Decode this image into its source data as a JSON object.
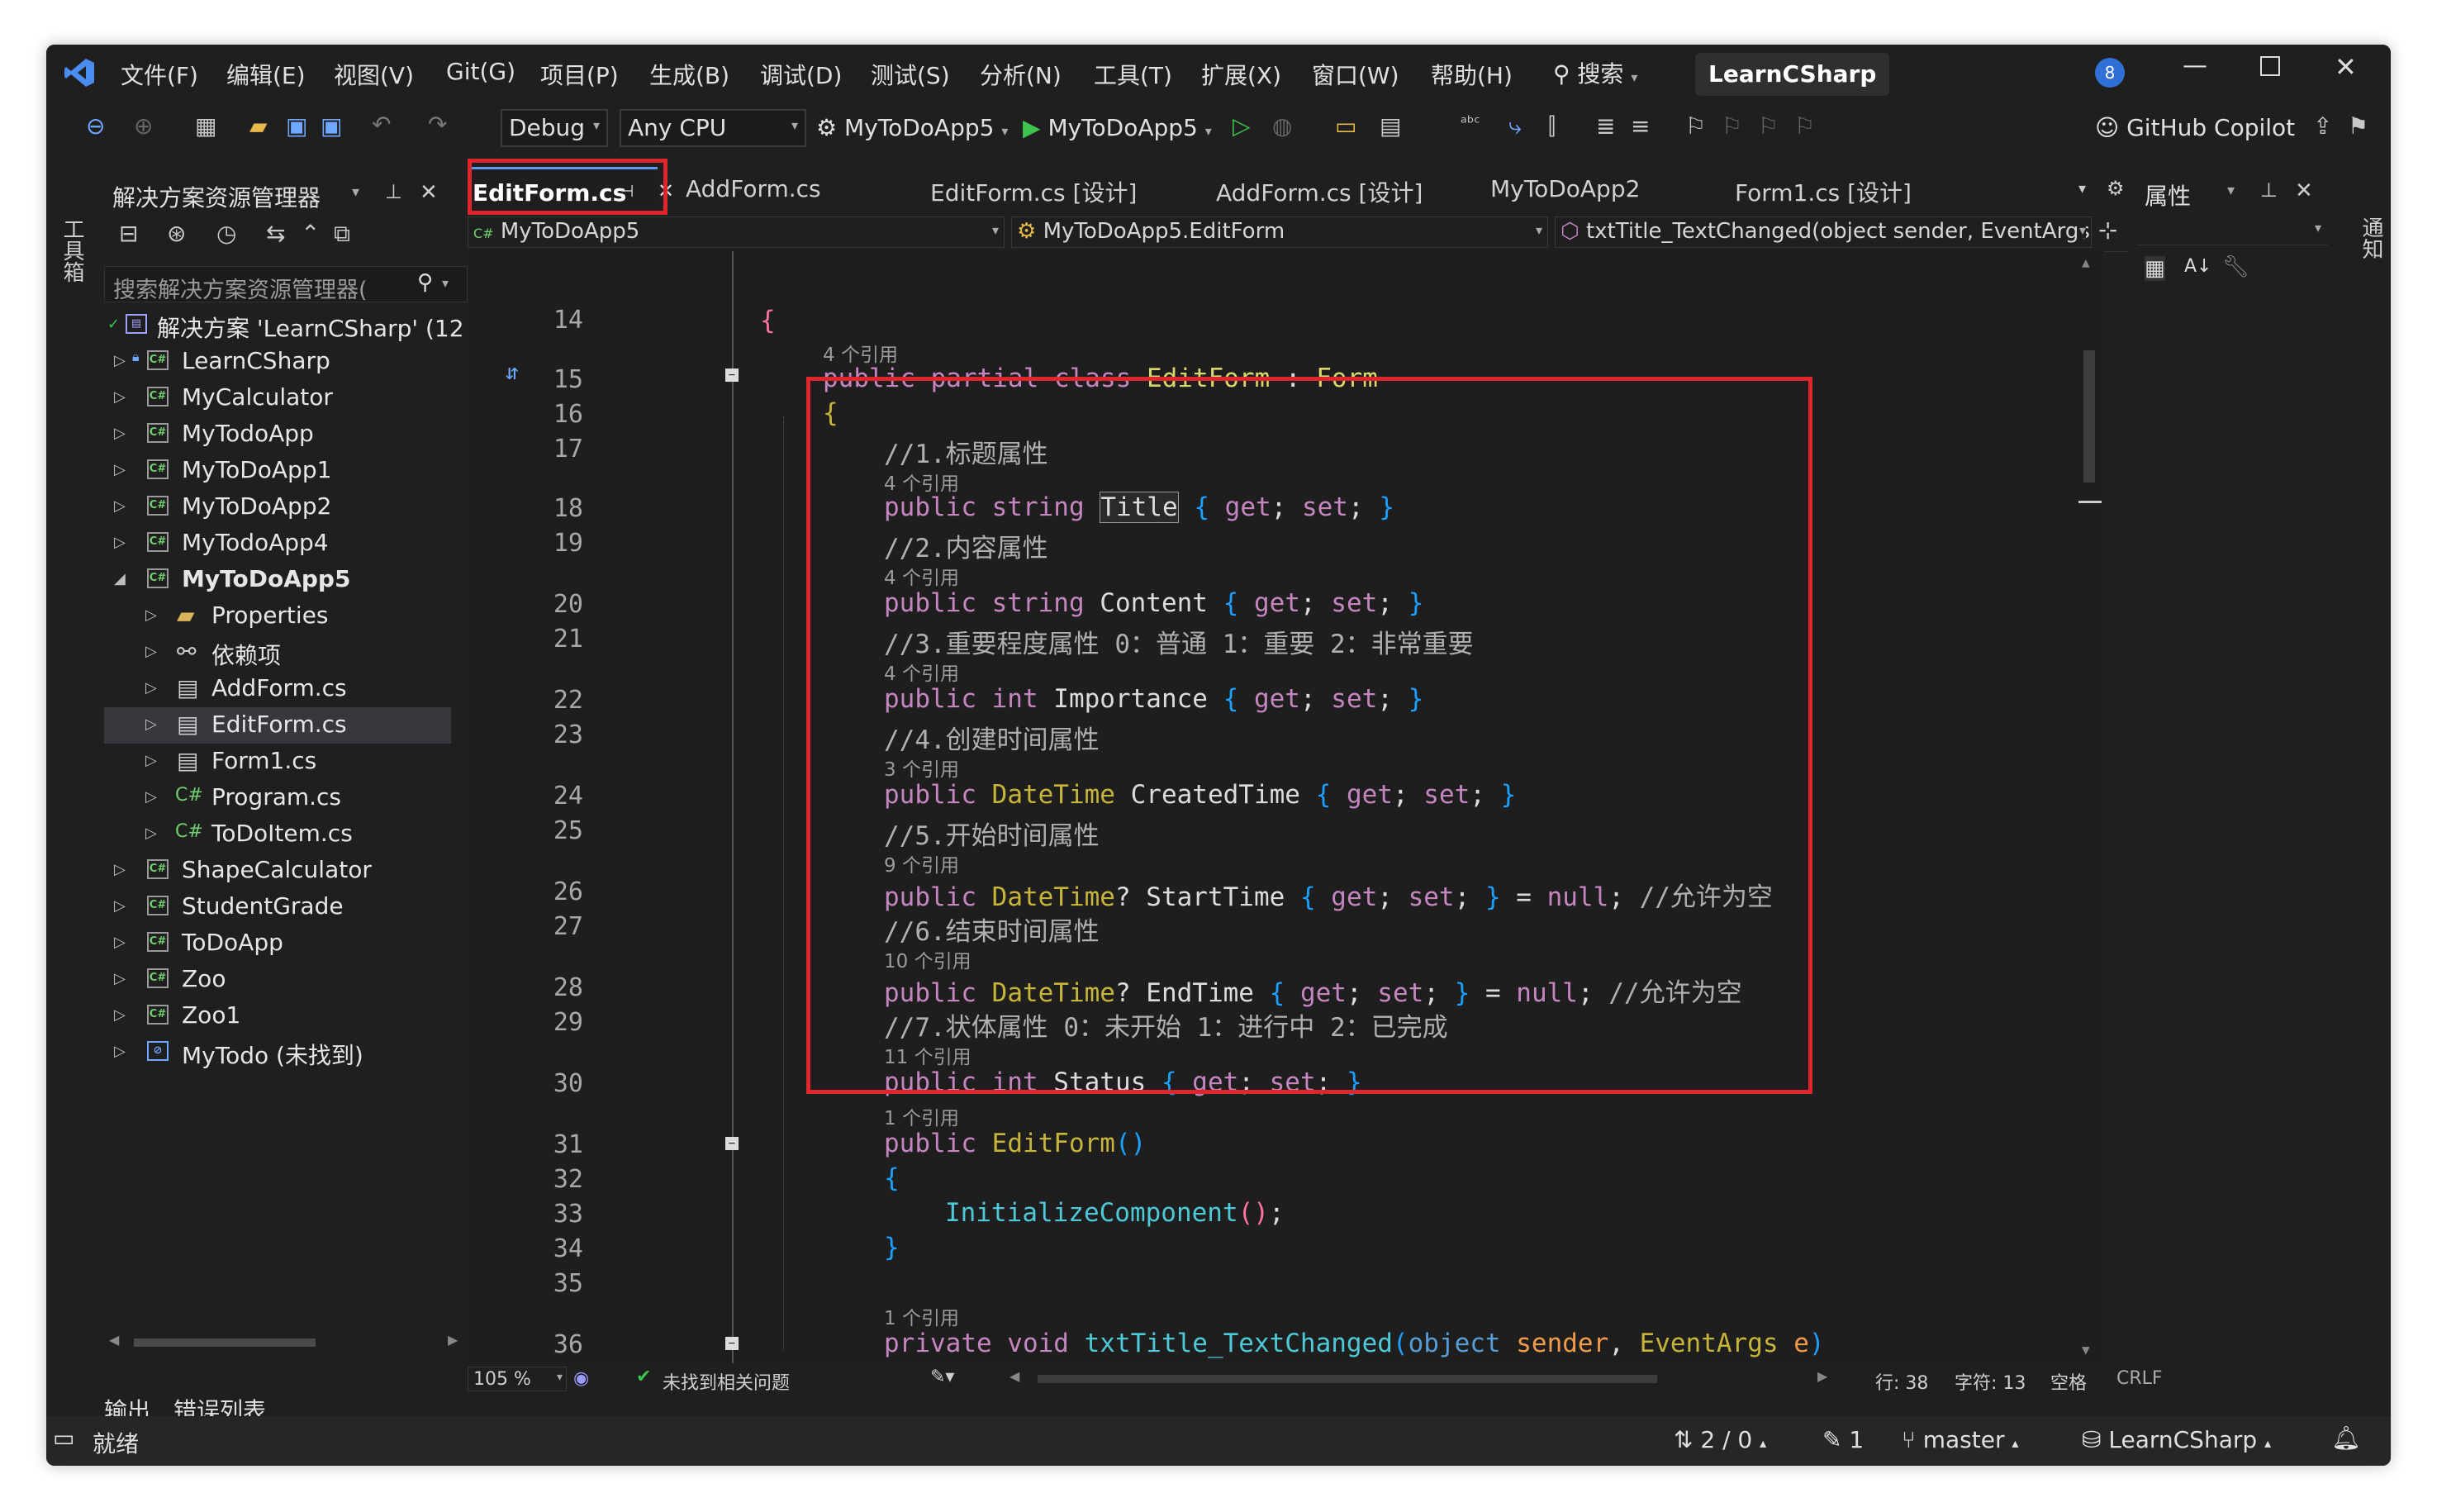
{
  "menu": {
    "items": [
      "文件(F)",
      "编辑(E)",
      "视图(V)",
      "Git(G)",
      "项目(P)",
      "生成(B)",
      "调试(D)",
      "测试(S)",
      "分析(N)",
      "工具(T)",
      "扩展(X)",
      "窗口(W)",
      "帮助(H)"
    ],
    "search_label": "搜索",
    "solution_name": "LearnCSharp",
    "notification_count": "8"
  },
  "toolbar": {
    "config": "Debug",
    "platform": "Any CPU",
    "startup_project": "MyToDoApp5",
    "run_label": "MyToDoApp5",
    "copilot": "GitHub Copilot"
  },
  "left_strip": {
    "label": "工具箱"
  },
  "right_strip": {
    "label": "通知"
  },
  "solution_explorer": {
    "title": "解决方案资源管理器",
    "search_placeholder": "搜索解决方案资源管理器(",
    "items": [
      {
        "label": "解决方案 'LearnCSharp' (12"
      },
      {
        "label": "LearnCSharp"
      },
      {
        "label": "MyCalculator"
      },
      {
        "label": "MyTodoApp"
      },
      {
        "label": "MyToDoApp1"
      },
      {
        "label": "MyToDoApp2"
      },
      {
        "label": "MyTodoApp4"
      },
      {
        "label": "MyToDoApp5"
      },
      {
        "label": "Properties"
      },
      {
        "label": "依赖项"
      },
      {
        "label": "AddForm.cs"
      },
      {
        "label": "EditForm.cs"
      },
      {
        "label": "Form1.cs"
      },
      {
        "label": "Program.cs"
      },
      {
        "label": "ToDoItem.cs"
      },
      {
        "label": "ShapeCalculator"
      },
      {
        "label": "StudentGrade"
      },
      {
        "label": "ToDoApp"
      },
      {
        "label": "Zoo"
      },
      {
        "label": "Zoo1"
      },
      {
        "label": "MyTodo (未找到)"
      }
    ]
  },
  "tabs": [
    "EditForm.cs",
    "AddForm.cs",
    "EditForm.cs [设计]",
    "AddForm.cs [设计]",
    "MyToDoApp2",
    "Form1.cs [设计]"
  ],
  "nav": {
    "project": "MyToDoApp5",
    "class": "MyToDoApp5.EditForm",
    "member": "txtTitle_TextChanged(object sender, EventArgs"
  },
  "editor": {
    "line_numbers": [
      "14",
      "15",
      "16",
      "17",
      "18",
      "19",
      "20",
      "21",
      "22",
      "23",
      "24",
      "25",
      "26",
      "27",
      "28",
      "29",
      "30",
      "31",
      "32",
      "33",
      "34",
      "35",
      "36"
    ],
    "refs": {
      "r4": "4 个引用",
      "r3": "3 个引用",
      "r9": "9 个引用",
      "r10": "10 个引用",
      "r11": "11 个引用",
      "r1": "1 个引用"
    },
    "comments": {
      "c1": "//1.标题属性",
      "c2": "//2.内容属性",
      "c3": "//3.重要程度属性 0：普通 1：重要 2：非常重要",
      "c4": "//4.创建时间属性",
      "c5": "//5.开始时间属性",
      "c6": "//6.结束时间属性",
      "c7": "//7.状体属性 0：未开始 1：进行中 2：已完成",
      "allow_null": "//允许为空"
    }
  },
  "editor_status": {
    "zoom": "105 %",
    "issues": "未找到相关问题",
    "line": "行: 38",
    "char": "字符: 13",
    "spaces": "空格",
    "eol": "CRLF"
  },
  "properties_panel": {
    "title": "属性"
  },
  "bottom_tabs": [
    "输出",
    "错误列表"
  ],
  "status": {
    "ready": "就绪",
    "changes": "2 / 0",
    "edits": "1",
    "branch": "master",
    "repo": "LearnCSharp"
  }
}
